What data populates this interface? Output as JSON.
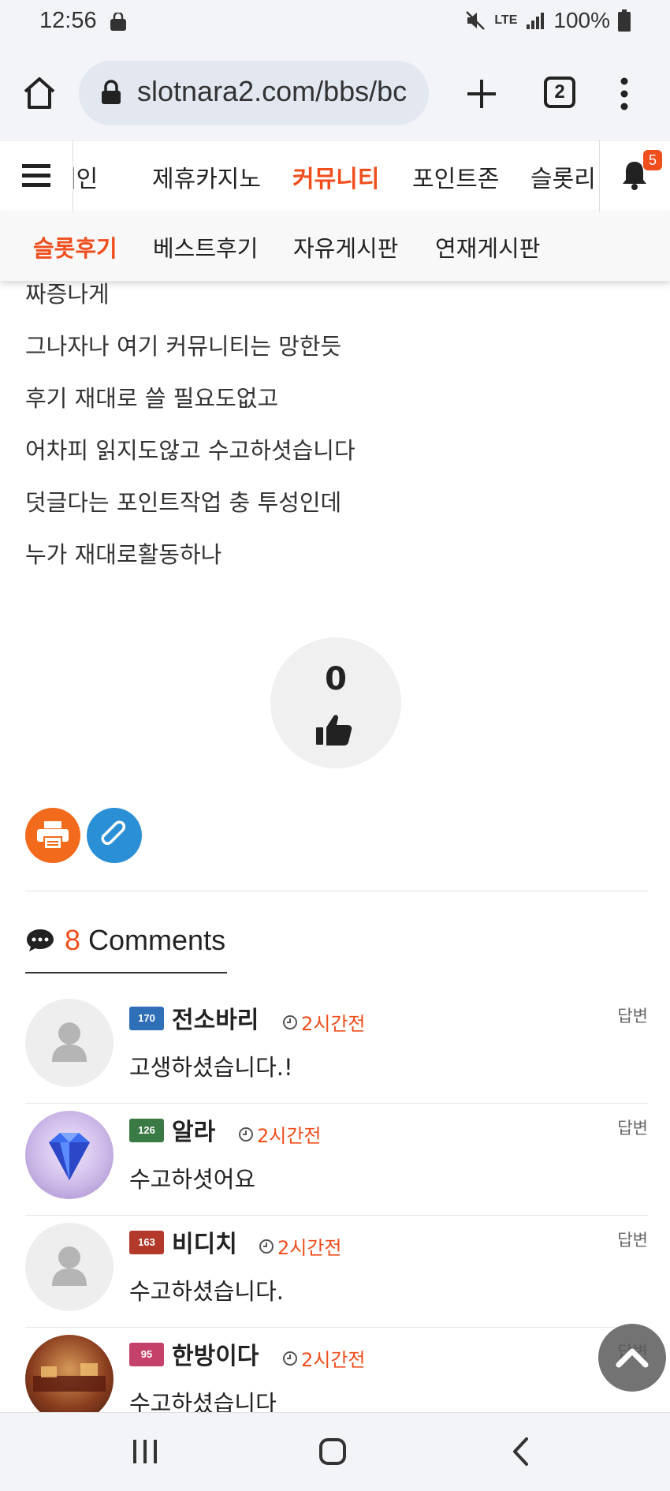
{
  "status_bar": {
    "time": "12:56",
    "network": "LTE",
    "battery": "100%"
  },
  "browser": {
    "url": "slotnara2.com/bbs/bc",
    "tab_count": "2"
  },
  "site_nav": {
    "items": [
      "메인",
      "제휴카지노",
      "커뮤니티",
      "포인트존",
      "슬롯리"
    ],
    "active": "커뮤니티",
    "notification_count": "5"
  },
  "sub_nav": {
    "items": [
      "슬롯후기",
      "베스트후기",
      "자유게시판",
      "연재게시판"
    ],
    "active": "슬롯후기"
  },
  "post": {
    "lines": [
      "짜증나게",
      "그나자나 여기 커뮤니티는 망한듯",
      "후기 재대로 쓸 필요도없고",
      "어차피 읽지도않고 수고하셧습니다",
      "덧글다는 포인트작업 충 투성인데",
      "누가 재대로활동하나"
    ],
    "like_count": "0"
  },
  "actions": {
    "print_icon": "printer-icon",
    "clip_icon": "paperclip-icon"
  },
  "comments_header": {
    "count": "8",
    "label": "Comments"
  },
  "comments": [
    {
      "level": "170",
      "name": "전소바리",
      "time": "2시간전",
      "reply": "답변",
      "text": "고생하셨습니다.!"
    },
    {
      "level": "126",
      "name": "알라",
      "time": "2시간전",
      "reply": "답변",
      "text": "수고하셧어요"
    },
    {
      "level": "163",
      "name": "비디치",
      "time": "2시간전",
      "reply": "답변",
      "text": "수고하셨습니다."
    },
    {
      "level": "95",
      "name": "한방이다",
      "time": "2시간전",
      "reply": "답변",
      "text": "수고하셨습니다"
    }
  ],
  "colors": {
    "accent": "#f04e1d",
    "print_button": "#f26a1b",
    "clip_button": "#2b8fd6"
  }
}
